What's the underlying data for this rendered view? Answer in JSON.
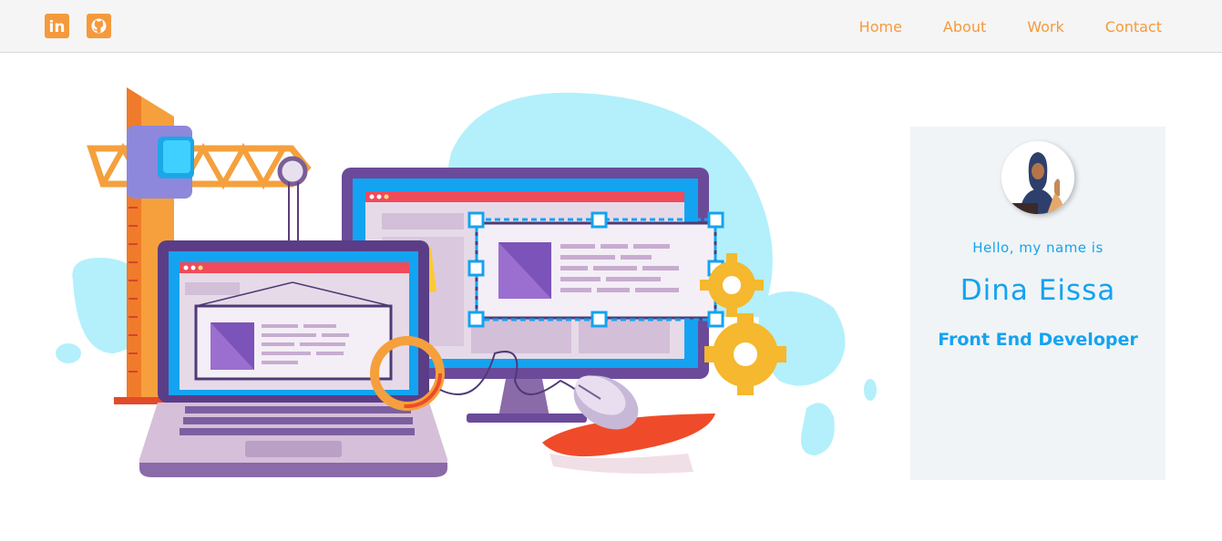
{
  "nav": {
    "social": [
      {
        "icon": "linkedin-icon",
        "label": "in"
      },
      {
        "icon": "github-icon"
      }
    ],
    "links": [
      "Home",
      "About",
      "Work",
      "Contact"
    ]
  },
  "hero": {
    "illustration": "web-development-illustration"
  },
  "profile": {
    "greeting": "Hello, my name is",
    "name": "Dina Eissa",
    "role": "Front End Developer"
  },
  "colors": {
    "accent_orange": "#f59a3c",
    "accent_blue": "#14a3f0",
    "navbar_bg": "#f5f5f5",
    "card_bg": "#f0f4f6"
  }
}
